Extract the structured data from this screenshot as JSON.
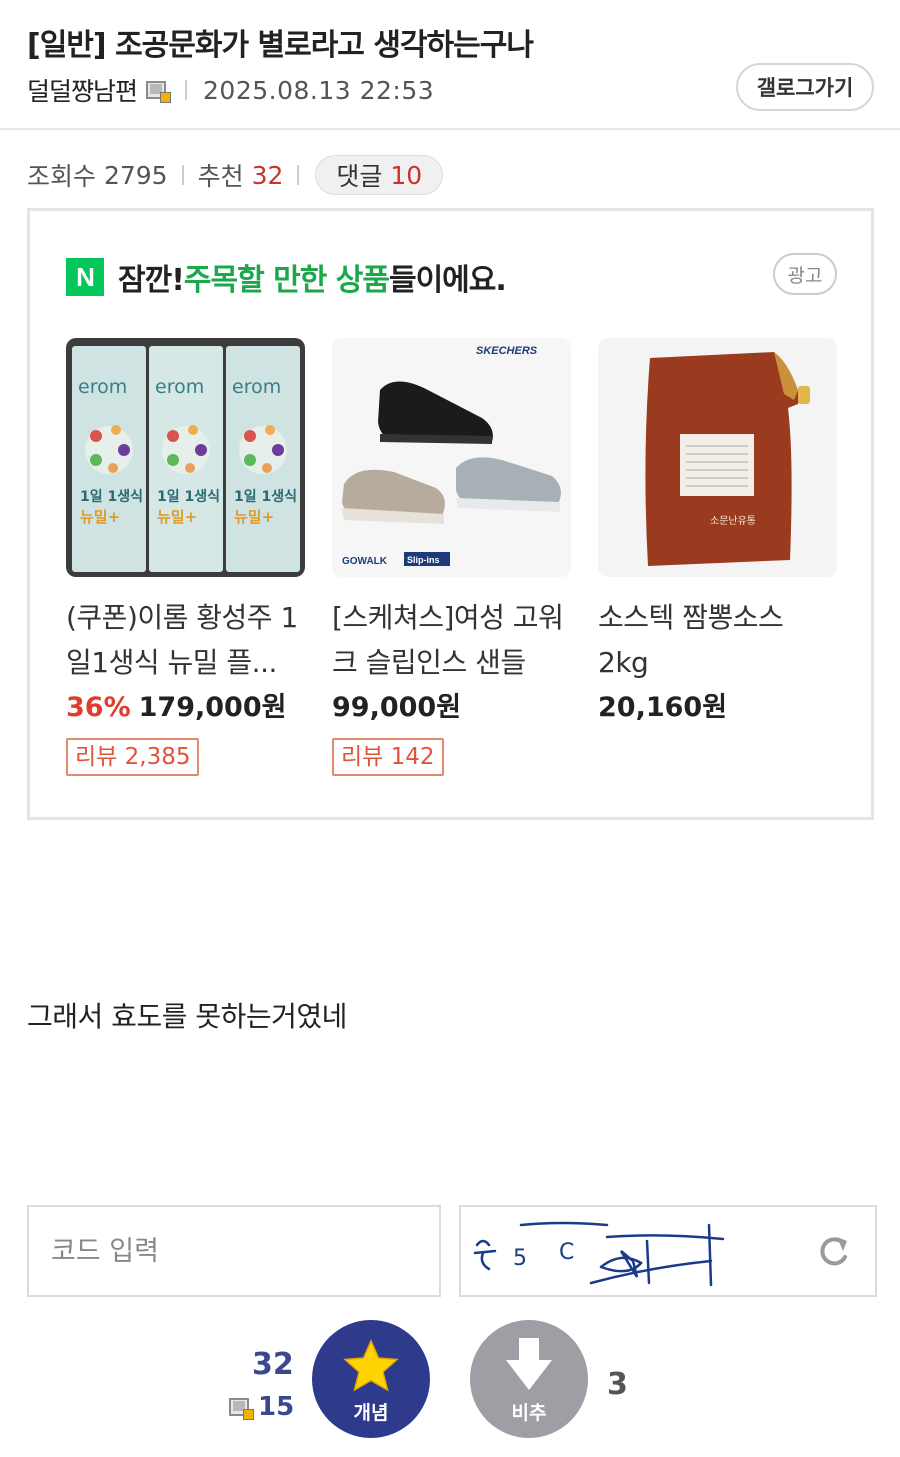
{
  "post": {
    "title": "[일반] 조공문화가 별로라고 생각하는구나",
    "author": "덜덜쨩남편",
    "date": "2025.08.13 22:53",
    "gallery_button": "갤로그가기",
    "views_label": "조회수",
    "views": "2795",
    "recommend_label": "추천",
    "recommend": "32",
    "comments_label": "댓글",
    "comments": "10",
    "body": "그래서 효도를 못하는거였네"
  },
  "ad": {
    "prefix": "잠깐! ",
    "highlight": "주목할 만한 상품",
    "suffix": "들이에요.",
    "tag": "광고",
    "products": [
      {
        "name": "(쿠폰)이롬 황성주 1일1생식 뉴밀 플...",
        "discount": "36%",
        "price": "179,000원",
        "review": "리뷰 2,385",
        "thumb_brand": "erom",
        "thumb_text": "1일 1생식",
        "thumb_sub": "뉴밀+"
      },
      {
        "name": "[스케쳐스]여성 고워크 슬립인스 샌들",
        "discount": "",
        "price": "99,000원",
        "review": "리뷰 142",
        "thumb_brand": "SKECHERS",
        "thumb_logo1": "GOWALK",
        "thumb_logo2": "Slip-ins"
      },
      {
        "name": "소스텍 짬뽕소스 2kg",
        "discount": "",
        "price": "20,160원",
        "review": "",
        "thumb_label": "소문난유통"
      }
    ]
  },
  "captcha": {
    "placeholder": "코드 입력",
    "image_text": "ㅊ5 C6 41"
  },
  "vote": {
    "up_count": "32",
    "fixed_count": "15",
    "up_label": "개념",
    "down_label": "비추",
    "down_count": "3"
  },
  "colors": {
    "accent_red": "#c8332e",
    "naver_green": "#03c75a",
    "vote_up": "#2e3a8c",
    "vote_down": "#9e9ea4"
  }
}
